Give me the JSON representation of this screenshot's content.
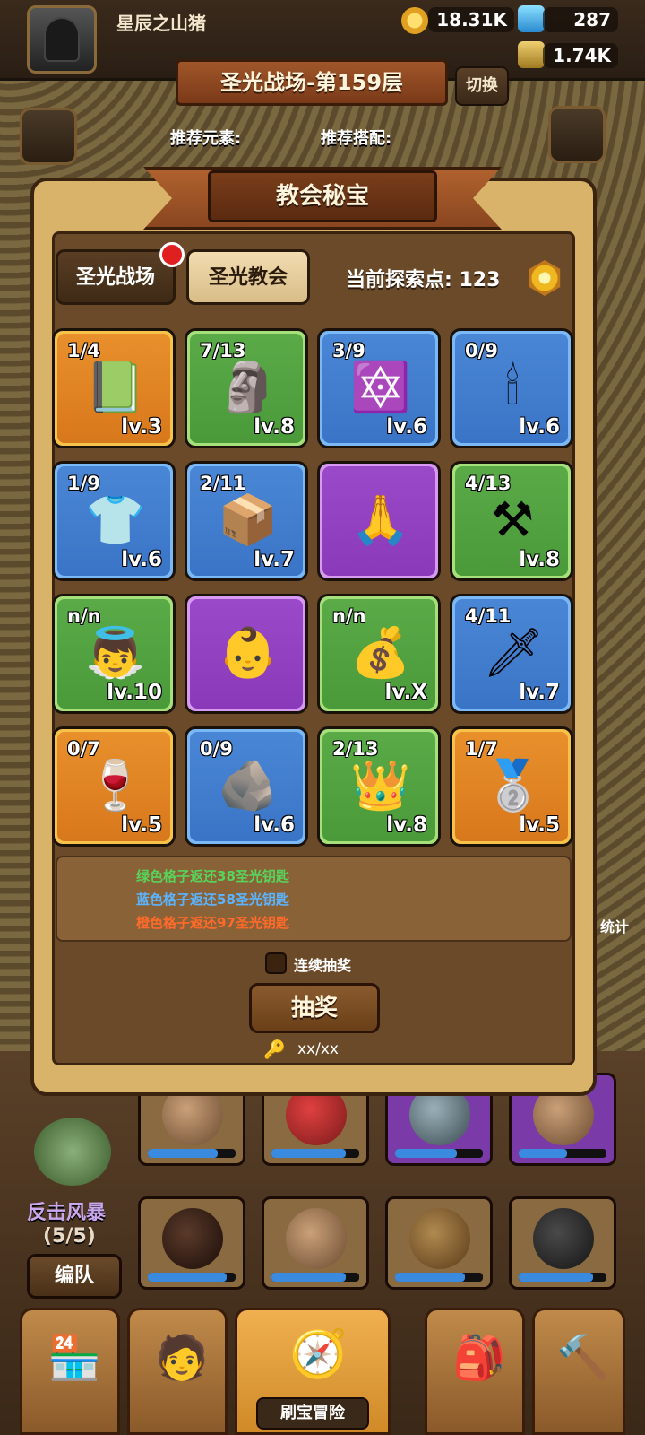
{
  "player": {
    "name": "星辰之山猪"
  },
  "resources": {
    "gold": "18.31K",
    "gems": "287",
    "potion": "1.74K"
  },
  "stage": {
    "title": "圣光战场-第159层",
    "switch_label": "切换"
  },
  "recommend": {
    "element_label": "推荐元素:",
    "combo_label": "推荐搭配:"
  },
  "panel": {
    "title": "教会秘宝",
    "tabs": [
      {
        "label": "圣光战场",
        "active": false,
        "has_notification": true
      },
      {
        "label": "圣光教会",
        "active": true
      }
    ],
    "explore_points": "当前探索点: 123",
    "tiles": [
      {
        "color": "orange",
        "count": "1/4",
        "level": "lv.3",
        "icon": "holy-book-icon",
        "glyph": "📗"
      },
      {
        "color": "green",
        "count": "7/13",
        "level": "lv.8",
        "icon": "angel-statue-icon",
        "glyph": "🗿"
      },
      {
        "color": "blue",
        "count": "3/9",
        "level": "lv.6",
        "icon": "magic-circle-icon",
        "glyph": "🔯"
      },
      {
        "color": "blue",
        "count": "0/9",
        "level": "lv.6",
        "icon": "candle-icon",
        "glyph": "🕯"
      },
      {
        "color": "blue",
        "count": "1/9",
        "level": "lv.6",
        "icon": "crusader-tunic-icon",
        "glyph": "👕"
      },
      {
        "color": "blue",
        "count": "2/11",
        "level": "lv.7",
        "icon": "wooden-box-icon",
        "glyph": "📦"
      },
      {
        "color": "purple",
        "count": "",
        "level": "",
        "icon": "praying-hands-cross-icon",
        "glyph": "🙏"
      },
      {
        "color": "green",
        "count": "4/13",
        "level": "lv.8",
        "icon": "anvil-icon",
        "glyph": "⚒"
      },
      {
        "color": "green",
        "count": "n/n",
        "level": "lv.10",
        "icon": "angel-wings-icon",
        "glyph": "👼"
      },
      {
        "color": "purple",
        "count": "",
        "level": "",
        "icon": "baby-bath-icon",
        "glyph": "👶"
      },
      {
        "color": "green",
        "count": "n/n",
        "level": "lv.X",
        "icon": "coin-pouch-icon",
        "glyph": "💰"
      },
      {
        "color": "blue",
        "count": "4/11",
        "level": "lv.7",
        "icon": "holy-sword-icon",
        "glyph": "🗡"
      },
      {
        "color": "orange",
        "count": "0/7",
        "level": "lv.5",
        "icon": "chalice-icon",
        "glyph": "🍷"
      },
      {
        "color": "blue",
        "count": "0/9",
        "level": "lv.6",
        "icon": "ore-stone-icon",
        "glyph": "🪨"
      },
      {
        "color": "green",
        "count": "2/13",
        "level": "lv.8",
        "icon": "crowned-spirit-icon",
        "glyph": "👑"
      },
      {
        "color": "orange",
        "count": "1/7",
        "level": "lv.5",
        "icon": "silver-ingot-icon",
        "glyph": "🥈"
      }
    ],
    "info": [
      {
        "text": "绿色格子返还38圣光钥匙",
        "color": "#57d45a"
      },
      {
        "text": "蓝色格子返还58圣光钥匙",
        "color": "#5ab4ff"
      },
      {
        "text": "橙色格子返还97圣光钥匙",
        "color": "#ff6a2a"
      }
    ],
    "continuous_draw_label": "连续抽奖",
    "draw_button": "抽奖",
    "key_count": "xx/xx"
  },
  "team": {
    "formation_name": "反击风暴",
    "formation_count": "(5/5)",
    "edit_button": "编队",
    "hp": [
      0.8,
      0.85,
      0.7,
      0.55,
      0.9,
      0.85,
      0.8,
      0.85
    ]
  },
  "side": {
    "stats_label": "统计"
  },
  "nav": {
    "active_label": "刷宝冒险"
  }
}
